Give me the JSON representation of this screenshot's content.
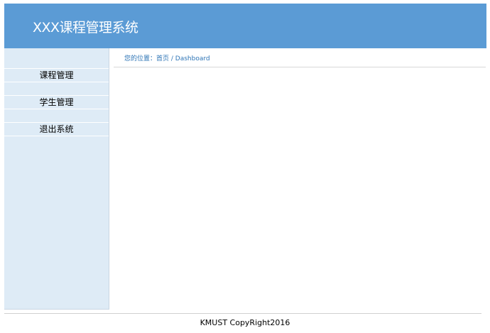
{
  "header": {
    "title": "XXX课程管理系统"
  },
  "sidebar": {
    "items": [
      {
        "label": "课程管理"
      },
      {
        "label": "学生管理"
      },
      {
        "label": "退出系统"
      }
    ]
  },
  "breadcrumb": {
    "prefix": "您的位置：",
    "home": "首页",
    "separator": " / ",
    "current": "Dashboard"
  },
  "footer": {
    "copyright": "KMUST CopyRight2016"
  },
  "colors": {
    "header_bg": "#5b9bd5",
    "sidebar_bg": "#deebf6",
    "breadcrumb_text": "#2e75b6"
  }
}
